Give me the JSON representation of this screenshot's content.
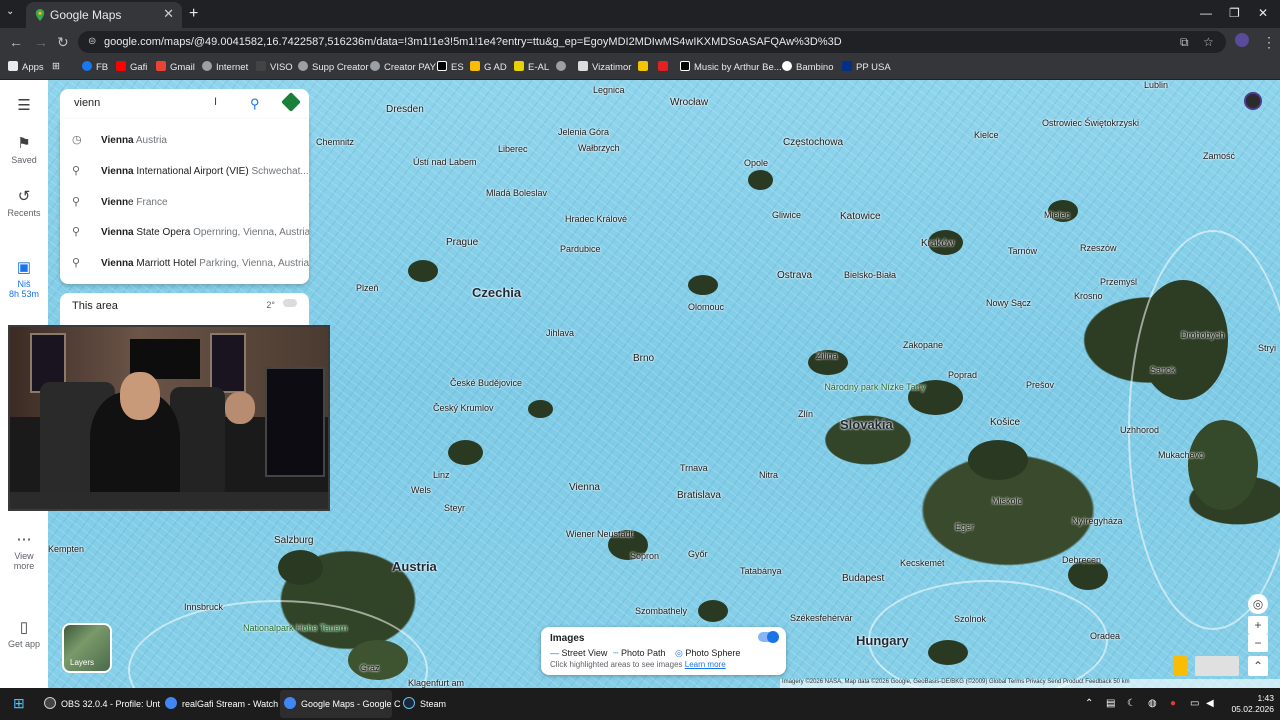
{
  "browser": {
    "tab_title": "Google Maps",
    "url": "google.com/maps/@49.0041582,16.7422587,516236m/data=!3m1!1e3!5m1!1e4?entry=ttu&g_ep=EgoyMDI2MDIwMS4wIKXMDSoASAFQAw%3D%3D",
    "bookmarks": [
      "Apps",
      "FB",
      "Gafi",
      "Gmail",
      "Internet",
      "VISO",
      "Supp Creator",
      "Creator PAY",
      "ES",
      "G AD",
      "E-AL",
      "Vizatimor",
      "Music by Arthur Be...",
      "Bambino",
      "PP USA"
    ]
  },
  "rail": {
    "saved": "Saved",
    "recents": "Recents",
    "recent_place": "Niš",
    "recent_time": "8h 53m",
    "view_more_1": "View",
    "view_more_2": "more",
    "get_app": "Get app"
  },
  "search": {
    "query": "vienn",
    "suggestions": [
      {
        "bold": "Vienna",
        "rest": "",
        "secondary": " Austria",
        "icon": "history-icon"
      },
      {
        "bold": "Vienna",
        "rest": " International Airport (VIE)",
        "secondary": " Schwechat...",
        "icon": "pin-icon"
      },
      {
        "bold": "Vienn",
        "rest": "e",
        "secondary": " France",
        "icon": "pin-icon"
      },
      {
        "bold": "Vienna",
        "rest": " State Opera",
        "secondary": " Opernring, Vienna, Austria",
        "icon": "pin-icon"
      },
      {
        "bold": "Vienna",
        "rest": " Marriott Hotel",
        "secondary": " Parkring, Vienna, Austria",
        "icon": "pin-icon"
      }
    ],
    "this_area": "This area",
    "weather": "2°"
  },
  "map_labels": {
    "countries": [
      "Czechia",
      "Slovakia",
      "Austria",
      "Hungary"
    ],
    "cities": [
      "Wrocław",
      "Dresden",
      "Częstochowa",
      "Katowice",
      "Kraków",
      "Prague",
      "Brno",
      "Ostrava",
      "Vienna",
      "Bratislava",
      "Linz",
      "Salzburg",
      "Budapest",
      "Košice",
      "Lublin",
      "Rzeszów",
      "Tarnów",
      "Miskolc",
      "Nyíregyháza",
      "Debrecen",
      "Graz",
      "Győr",
      "Zakopane",
      "Poprad",
      "Kielce",
      "Opole",
      "Olomouc",
      "Liberec",
      "Pardubice",
      "Plzeň",
      "Jihlava",
      "Trnava",
      "Nitra",
      "Žilina",
      "Sopron",
      "Szombathely",
      "Innsbruck",
      "Wels",
      "Steyr",
      "Chemnitz",
      "Legnica",
      "Zamość",
      "Przemyśl",
      "Uzhhorod",
      "Mukachevo",
      "Kempten",
      "Klagenfurt am",
      "Zlín",
      "Bielsko-Biała",
      "Gliwice",
      "Nowy Sącz",
      "Krosno",
      "Szolnok",
      "Kecskemét",
      "Székesfehérvár",
      "Tatabánya",
      "Eger",
      "Oradea",
      "Wałbrzych",
      "Jelenia Góra",
      "Ústí nad Labem",
      "Mladá Boleslav",
      "Hradec Králové",
      "České Budějovice",
      "Český Krumlov",
      "Wiener Neustadt",
      "Ostrowiec Świętokrzyski",
      "Mielec",
      "Sanok",
      "Prešov",
      "Stryi",
      "Drohobych"
    ],
    "parks": [
      "Národný park Nízke Tatry",
      "Nationalpark Hohe Tauern"
    ]
  },
  "layers_label": "Layers",
  "legend": {
    "title": "Images",
    "street_view": "Street View",
    "photo_path": "Photo Path",
    "photo_sphere": "Photo Sphere",
    "hint": "Click highlighted areas to see images",
    "learn_more": "Learn more"
  },
  "attribution": "Imagery ©2026 NASA, Map data ©2026 Google, GeoBasis-DE/BKG (©2009)   Global   Terms   Privacy   Send Product Feedback   50 km",
  "taskbar": {
    "items": [
      "OBS 32.0.4 - Profile: Unt",
      "realGafi Stream - Watch",
      "Google Maps - Google C",
      "Steam"
    ],
    "time": "1:43",
    "date": "05.02.2026"
  },
  "colors": {
    "accent": "#1a73e8",
    "map_water": "#86cfe8",
    "taskbar": "#1c1c1c"
  }
}
